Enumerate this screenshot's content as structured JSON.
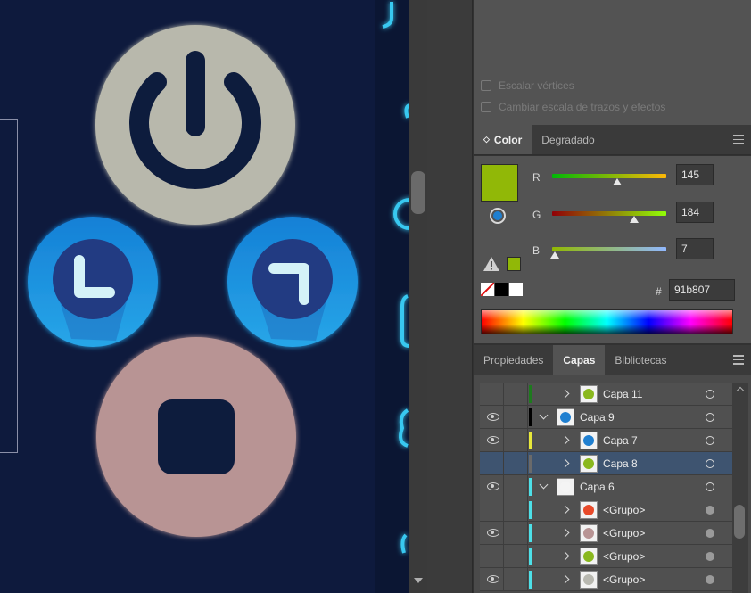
{
  "transform_panel": {
    "scale_corners_label": "Escalar vértices",
    "scale_strokes_label": "Cambiar escala de trazos y efectos"
  },
  "color_panel": {
    "tabs": [
      "Color",
      "Degradado"
    ],
    "fill_color": "#91b807",
    "r_label": "R",
    "g_label": "G",
    "b_label": "B",
    "r_value": "145",
    "g_value": "184",
    "b_value": "7",
    "r_fraction": 0.569,
    "g_fraction": 0.722,
    "b_fraction": 0.027,
    "hex_label": "#",
    "hex_value": "91b807"
  },
  "layers_panel": {
    "tabs": [
      "Propiedades",
      "Capas",
      "Bibliotecas"
    ],
    "rows": [
      {
        "name": "Capa 11",
        "visible": false,
        "level": 1,
        "expand": "right",
        "color": "#1e7a1e",
        "thumb_color": "#8ab81e",
        "target": "outline",
        "selected": false
      },
      {
        "name": "Capa 9",
        "visible": true,
        "level": 0,
        "expand": "down",
        "color": "#000000",
        "thumb_color": "#1f7fd0",
        "target": "outline",
        "selected": false
      },
      {
        "name": "Capa 7",
        "visible": true,
        "level": 1,
        "expand": "right",
        "color": "#e8e83a",
        "thumb_color": "#1f7fd0",
        "target": "outline",
        "selected": false
      },
      {
        "name": "Capa 8",
        "visible": false,
        "level": 1,
        "expand": "right",
        "color": "#6a6a6a",
        "thumb_color": "#8ab81e",
        "target": "outline",
        "selected": true
      },
      {
        "name": "Capa 6",
        "visible": true,
        "level": 0,
        "expand": "down",
        "color": "#4de0e8",
        "thumb_color": "#f4f4f4",
        "target": "outline",
        "selected": false
      },
      {
        "name": "<Grupo>",
        "visible": false,
        "level": 1,
        "expand": "right",
        "color": "#4de0e8",
        "thumb_color": "#e84a2a",
        "target": "filled",
        "selected": false
      },
      {
        "name": "<Grupo>",
        "visible": true,
        "level": 1,
        "expand": "right",
        "color": "#4de0e8",
        "thumb_color": "#b89494",
        "target": "filled",
        "selected": false
      },
      {
        "name": "<Grupo>",
        "visible": false,
        "level": 1,
        "expand": "right",
        "color": "#4de0e8",
        "thumb_color": "#8ab81e",
        "target": "filled",
        "selected": false
      },
      {
        "name": "<Grupo>",
        "visible": true,
        "level": 1,
        "expand": "right",
        "color": "#4de0e8",
        "thumb_color": "#b8b8b0",
        "target": "filled",
        "selected": false
      }
    ]
  },
  "canvas": {
    "background": "#0e1a3d",
    "icons": [
      "power-icon",
      "clock-icon",
      "clock-icon-alt",
      "stop-icon"
    ],
    "colors": {
      "power": "#b8b8ac",
      "clock": "#1f90d8",
      "stop": "#b89494"
    }
  }
}
